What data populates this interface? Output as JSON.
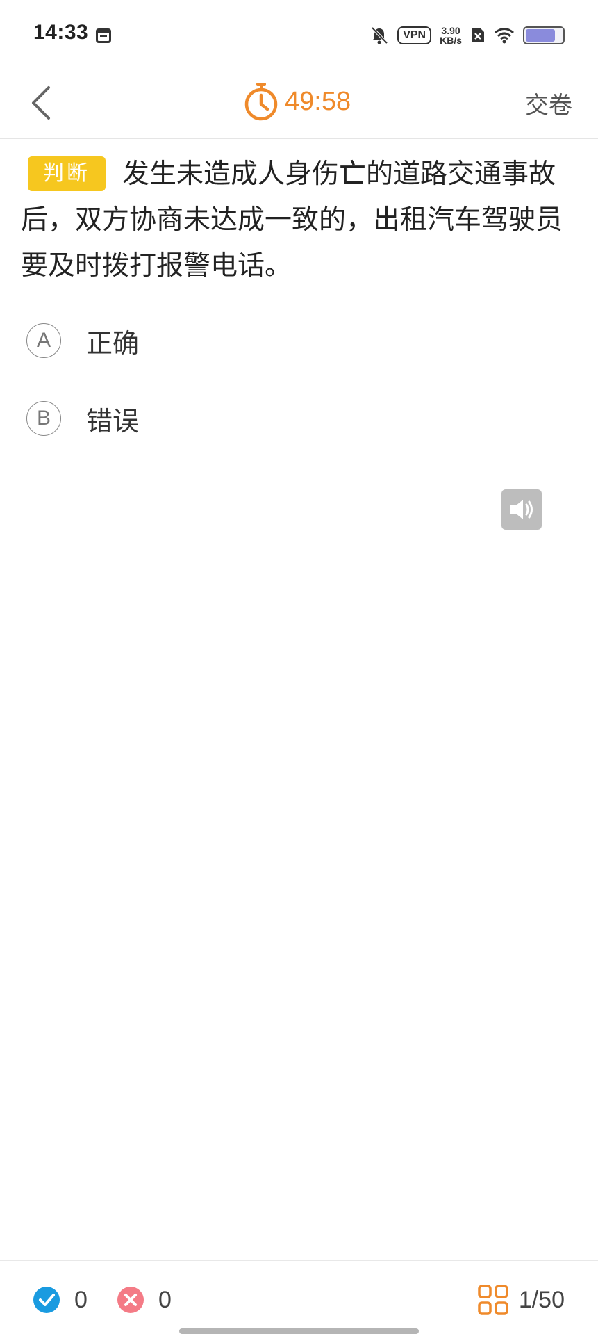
{
  "status_bar": {
    "time": "14:33",
    "vpn_label": "VPN",
    "speed_value": "3.90",
    "speed_unit": "KB/s",
    "battery_level": 0.84
  },
  "nav": {
    "timer": "49:58",
    "submit_label": "交卷"
  },
  "question": {
    "type_tag": "判断",
    "text": "发生未造成人身伤亡的道路交通事故后，双方协商未达成一致的，出租汽车驾驶员要及时拨打报警电话。",
    "options": [
      {
        "letter": "A",
        "text": "正确"
      },
      {
        "letter": "B",
        "text": "错误"
      }
    ]
  },
  "bottom_bar": {
    "correct_count": "0",
    "wrong_count": "0",
    "progress": "1/50"
  },
  "colors": {
    "accent_orange": "#ef8a2b",
    "tag_yellow": "#f6c71f",
    "correct_blue": "#1a9be0",
    "wrong_pink": "#f47b86"
  }
}
